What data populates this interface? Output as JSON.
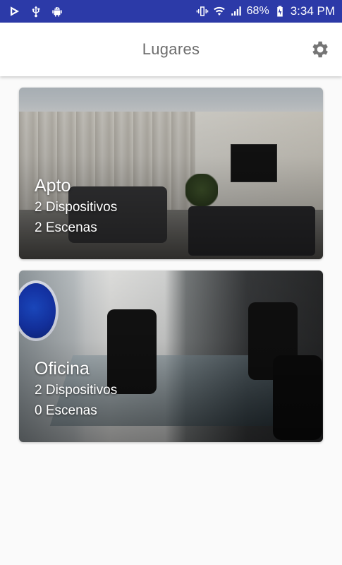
{
  "status_bar": {
    "battery_percent": "68%",
    "time": "3:34 PM",
    "icons": [
      "play-store-download-icon",
      "usb-icon",
      "android-icon",
      "vibrate-icon",
      "wifi-icon",
      "signal-icon",
      "battery-charging-icon"
    ],
    "background_color": "#2c3aa8"
  },
  "app_bar": {
    "title": "Lugares",
    "settings_icon": "gear-icon"
  },
  "places": [
    {
      "name": "Apto",
      "devices": "2 Dispositivos",
      "scenes": "2 Escenas"
    },
    {
      "name": "Oficina",
      "devices": "2 Dispositivos",
      "scenes": "0 Escenas"
    }
  ]
}
